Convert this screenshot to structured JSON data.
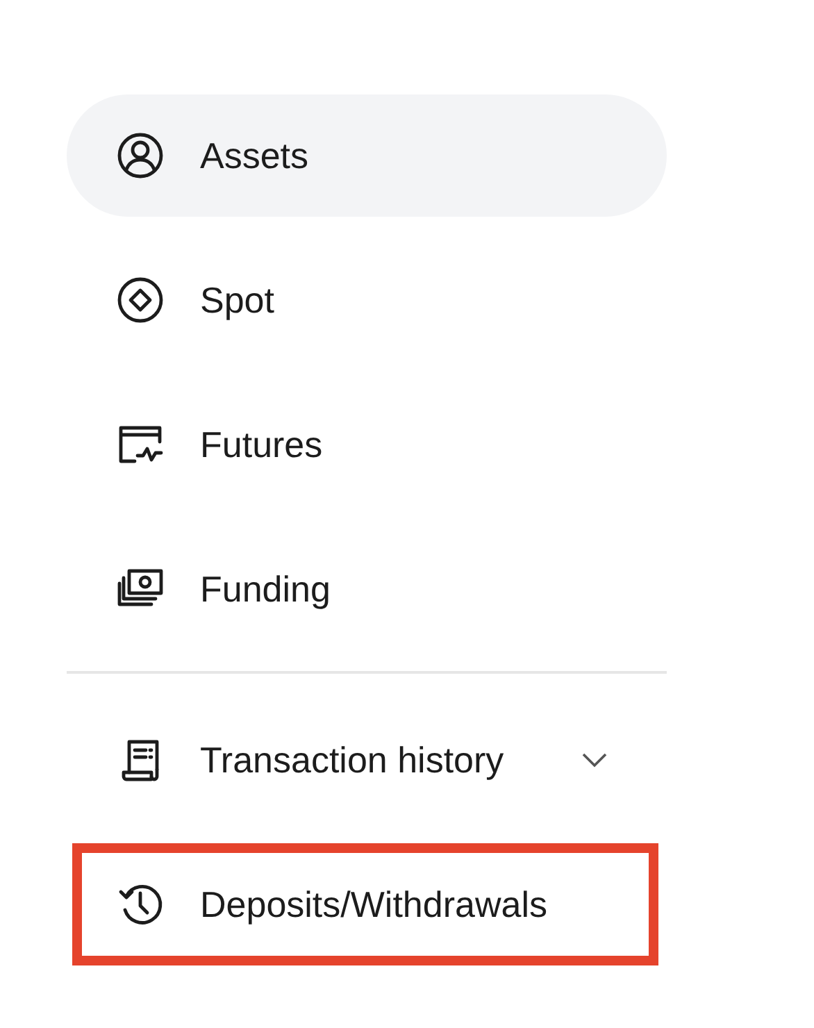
{
  "sections": [
    {
      "items": [
        {
          "kind": "link",
          "label": "Assets",
          "selected": true,
          "highlighted": false
        },
        {
          "kind": "link",
          "label": "Spot",
          "selected": false,
          "highlighted": false
        },
        {
          "kind": "link",
          "label": "Futures",
          "selected": false,
          "highlighted": false
        },
        {
          "kind": "link",
          "label": "Funding",
          "selected": false,
          "highlighted": false
        }
      ]
    },
    {
      "items": [
        {
          "kind": "expandable",
          "label": "Transaction history",
          "selected": false,
          "expanded": false,
          "highlighted": false
        },
        {
          "kind": "link",
          "label": "Deposits/Withdrawals",
          "selected": false,
          "highlighted": true
        }
      ]
    }
  ]
}
